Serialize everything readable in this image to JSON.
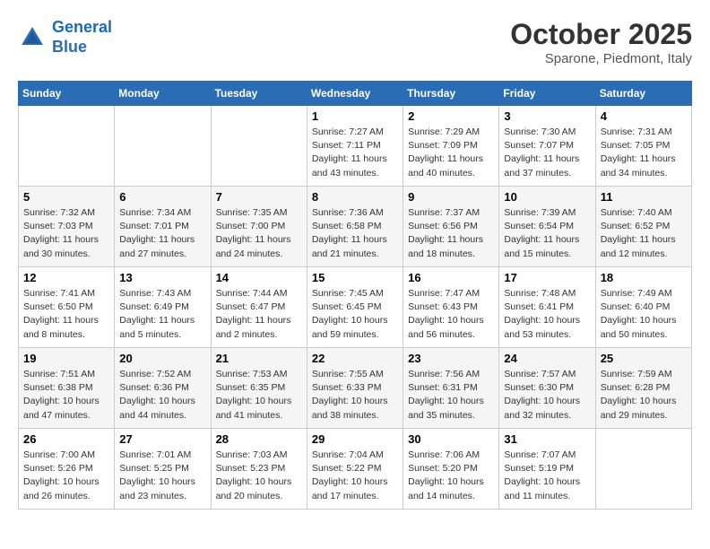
{
  "header": {
    "logo_line1": "General",
    "logo_line2": "Blue",
    "month": "October 2025",
    "location": "Sparone, Piedmont, Italy"
  },
  "weekdays": [
    "Sunday",
    "Monday",
    "Tuesday",
    "Wednesday",
    "Thursday",
    "Friday",
    "Saturday"
  ],
  "weeks": [
    [
      {
        "day": "",
        "info": ""
      },
      {
        "day": "",
        "info": ""
      },
      {
        "day": "",
        "info": ""
      },
      {
        "day": "1",
        "info": "Sunrise: 7:27 AM\nSunset: 7:11 PM\nDaylight: 11 hours\nand 43 minutes."
      },
      {
        "day": "2",
        "info": "Sunrise: 7:29 AM\nSunset: 7:09 PM\nDaylight: 11 hours\nand 40 minutes."
      },
      {
        "day": "3",
        "info": "Sunrise: 7:30 AM\nSunset: 7:07 PM\nDaylight: 11 hours\nand 37 minutes."
      },
      {
        "day": "4",
        "info": "Sunrise: 7:31 AM\nSunset: 7:05 PM\nDaylight: 11 hours\nand 34 minutes."
      }
    ],
    [
      {
        "day": "5",
        "info": "Sunrise: 7:32 AM\nSunset: 7:03 PM\nDaylight: 11 hours\nand 30 minutes."
      },
      {
        "day": "6",
        "info": "Sunrise: 7:34 AM\nSunset: 7:01 PM\nDaylight: 11 hours\nand 27 minutes."
      },
      {
        "day": "7",
        "info": "Sunrise: 7:35 AM\nSunset: 7:00 PM\nDaylight: 11 hours\nand 24 minutes."
      },
      {
        "day": "8",
        "info": "Sunrise: 7:36 AM\nSunset: 6:58 PM\nDaylight: 11 hours\nand 21 minutes."
      },
      {
        "day": "9",
        "info": "Sunrise: 7:37 AM\nSunset: 6:56 PM\nDaylight: 11 hours\nand 18 minutes."
      },
      {
        "day": "10",
        "info": "Sunrise: 7:39 AM\nSunset: 6:54 PM\nDaylight: 11 hours\nand 15 minutes."
      },
      {
        "day": "11",
        "info": "Sunrise: 7:40 AM\nSunset: 6:52 PM\nDaylight: 11 hours\nand 12 minutes."
      }
    ],
    [
      {
        "day": "12",
        "info": "Sunrise: 7:41 AM\nSunset: 6:50 PM\nDaylight: 11 hours\nand 8 minutes."
      },
      {
        "day": "13",
        "info": "Sunrise: 7:43 AM\nSunset: 6:49 PM\nDaylight: 11 hours\nand 5 minutes."
      },
      {
        "day": "14",
        "info": "Sunrise: 7:44 AM\nSunset: 6:47 PM\nDaylight: 11 hours\nand 2 minutes."
      },
      {
        "day": "15",
        "info": "Sunrise: 7:45 AM\nSunset: 6:45 PM\nDaylight: 10 hours\nand 59 minutes."
      },
      {
        "day": "16",
        "info": "Sunrise: 7:47 AM\nSunset: 6:43 PM\nDaylight: 10 hours\nand 56 minutes."
      },
      {
        "day": "17",
        "info": "Sunrise: 7:48 AM\nSunset: 6:41 PM\nDaylight: 10 hours\nand 53 minutes."
      },
      {
        "day": "18",
        "info": "Sunrise: 7:49 AM\nSunset: 6:40 PM\nDaylight: 10 hours\nand 50 minutes."
      }
    ],
    [
      {
        "day": "19",
        "info": "Sunrise: 7:51 AM\nSunset: 6:38 PM\nDaylight: 10 hours\nand 47 minutes."
      },
      {
        "day": "20",
        "info": "Sunrise: 7:52 AM\nSunset: 6:36 PM\nDaylight: 10 hours\nand 44 minutes."
      },
      {
        "day": "21",
        "info": "Sunrise: 7:53 AM\nSunset: 6:35 PM\nDaylight: 10 hours\nand 41 minutes."
      },
      {
        "day": "22",
        "info": "Sunrise: 7:55 AM\nSunset: 6:33 PM\nDaylight: 10 hours\nand 38 minutes."
      },
      {
        "day": "23",
        "info": "Sunrise: 7:56 AM\nSunset: 6:31 PM\nDaylight: 10 hours\nand 35 minutes."
      },
      {
        "day": "24",
        "info": "Sunrise: 7:57 AM\nSunset: 6:30 PM\nDaylight: 10 hours\nand 32 minutes."
      },
      {
        "day": "25",
        "info": "Sunrise: 7:59 AM\nSunset: 6:28 PM\nDaylight: 10 hours\nand 29 minutes."
      }
    ],
    [
      {
        "day": "26",
        "info": "Sunrise: 7:00 AM\nSunset: 5:26 PM\nDaylight: 10 hours\nand 26 minutes."
      },
      {
        "day": "27",
        "info": "Sunrise: 7:01 AM\nSunset: 5:25 PM\nDaylight: 10 hours\nand 23 minutes."
      },
      {
        "day": "28",
        "info": "Sunrise: 7:03 AM\nSunset: 5:23 PM\nDaylight: 10 hours\nand 20 minutes."
      },
      {
        "day": "29",
        "info": "Sunrise: 7:04 AM\nSunset: 5:22 PM\nDaylight: 10 hours\nand 17 minutes."
      },
      {
        "day": "30",
        "info": "Sunrise: 7:06 AM\nSunset: 5:20 PM\nDaylight: 10 hours\nand 14 minutes."
      },
      {
        "day": "31",
        "info": "Sunrise: 7:07 AM\nSunset: 5:19 PM\nDaylight: 10 hours\nand 11 minutes."
      },
      {
        "day": "",
        "info": ""
      }
    ]
  ]
}
